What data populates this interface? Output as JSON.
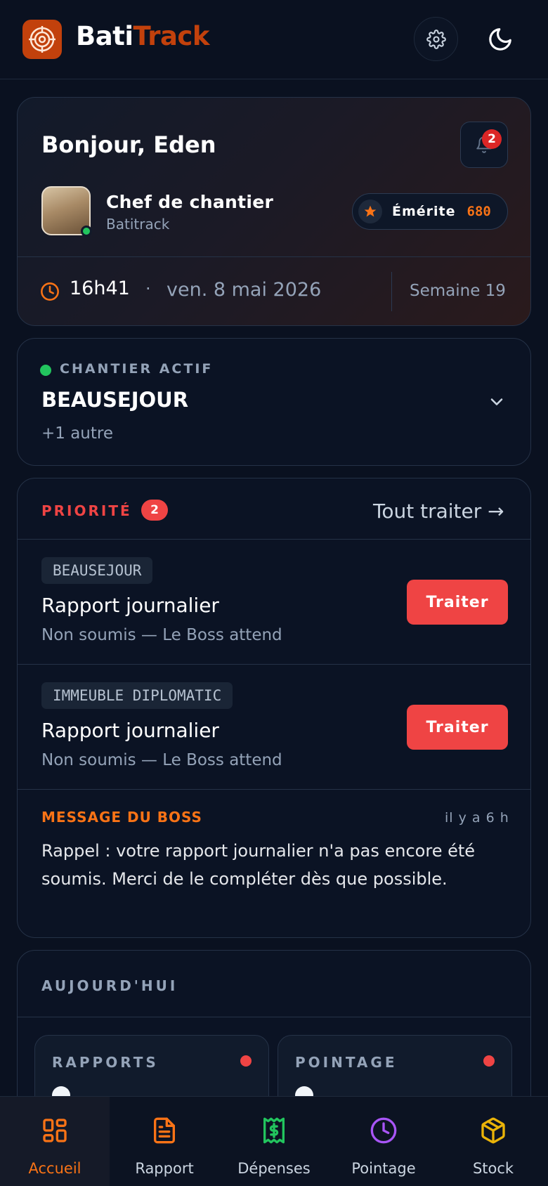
{
  "header": {
    "brand_part1": "Bati",
    "brand_part2": "Track",
    "accent_color": "#c2410c",
    "icons": [
      "target-logo-icon",
      "gear-icon",
      "moon-icon"
    ]
  },
  "hero": {
    "greeting": "Bonjour, Eden",
    "notifications_count": "2",
    "role": "Chef de chantier",
    "company": "Batitrack",
    "rank_label": "Émérite",
    "rank_points": "680",
    "time": "16h41",
    "separator": "·",
    "date": "ven. 8 mai 2026",
    "week": "Semaine 19"
  },
  "site": {
    "label": "CHANTIER ACTIF",
    "name": "BEAUSEJOUR",
    "more": "+1 autre"
  },
  "priority": {
    "title": "PRIORITÉ",
    "count": "2",
    "treat_all": "Tout traiter →",
    "items": [
      {
        "tag": "BEAUSEJOUR",
        "title": "Rapport journalier",
        "subtitle": "Non soumis — Le Boss attend",
        "action": "Traiter"
      },
      {
        "tag": "IMMEUBLE DIPLOMATIC",
        "title": "Rapport journalier",
        "subtitle": "Non soumis — Le Boss attend",
        "action": "Traiter"
      }
    ],
    "message_label": "MESSAGE DU BOSS",
    "message_time": "il y a 6 h",
    "message_text": "Rappel : votre rapport journalier n'a pas encore été soumis. Merci de le compléter dès que possible."
  },
  "today": {
    "title": "AUJOURD'HUI",
    "cards": [
      {
        "title": "RAPPORTS"
      },
      {
        "title": "POINTAGE"
      }
    ]
  },
  "tabs": [
    {
      "label": "Accueil",
      "icon": "grid-icon",
      "color": "#f97316"
    },
    {
      "label": "Rapport",
      "icon": "document-icon",
      "color": "#f97316"
    },
    {
      "label": "Dépenses",
      "icon": "receipt-dollar-icon",
      "color": "#22c55e"
    },
    {
      "label": "Pointage",
      "icon": "clock-icon",
      "color": "#a855f7"
    },
    {
      "label": "Stock",
      "icon": "box-icon",
      "color": "#eab308"
    }
  ]
}
